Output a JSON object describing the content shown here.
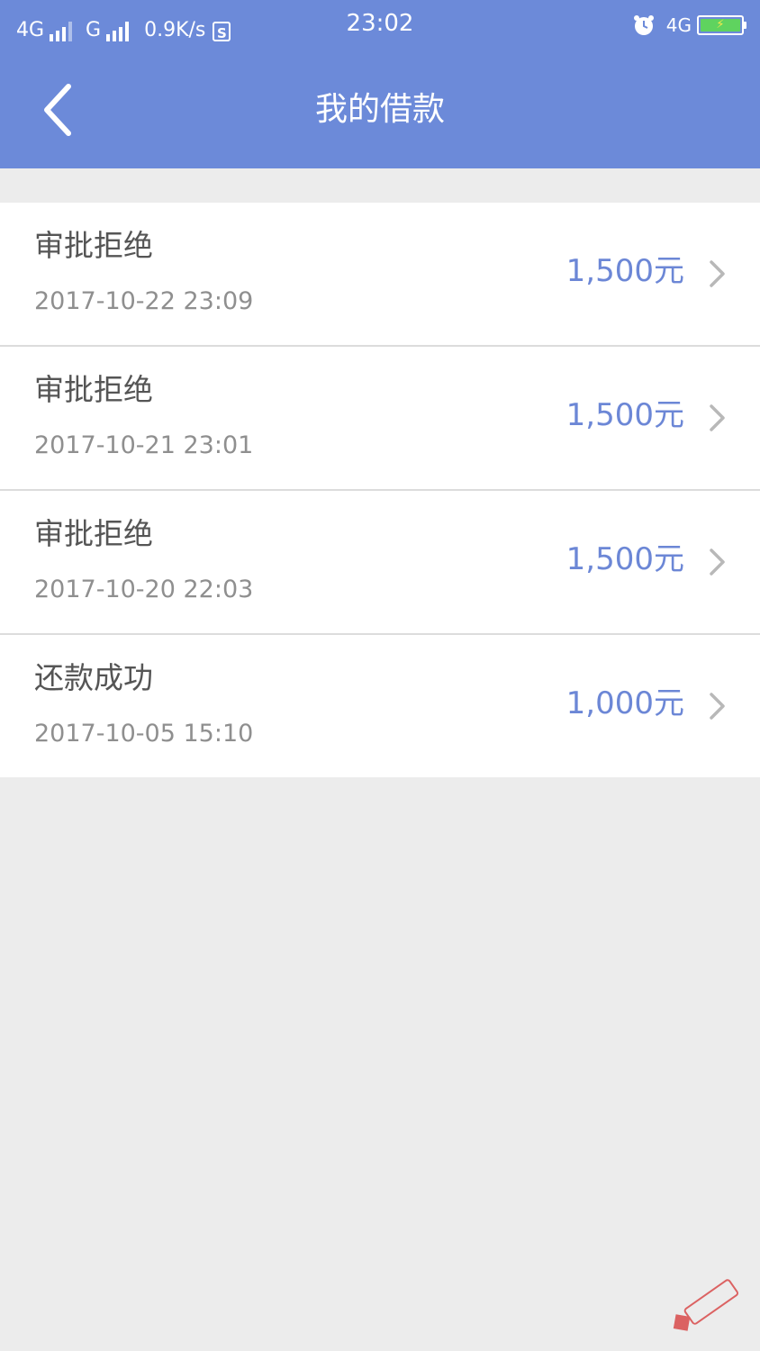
{
  "status_bar": {
    "network1": "4G",
    "network2": "G",
    "speed": "0.9K/s",
    "s_icon": "S",
    "time": "23:02",
    "right_network": "4G",
    "alarm_icon": "alarm-clock-icon",
    "battery_icon": "battery-charging-icon"
  },
  "nav": {
    "title": "我的借款",
    "back_icon": "chevron-left-icon"
  },
  "loans": [
    {
      "status": "审批拒绝",
      "time": "2017-10-22 23:09",
      "amount": "1,500元"
    },
    {
      "status": "审批拒绝",
      "time": "2017-10-21 23:01",
      "amount": "1,500元"
    },
    {
      "status": "审批拒绝",
      "time": "2017-10-20 22:03",
      "amount": "1,500元"
    },
    {
      "status": "还款成功",
      "time": "2017-10-05 15:10",
      "amount": "1,000元"
    }
  ],
  "colors": {
    "header": "#6c8ad9",
    "amount": "#6c87d6",
    "background": "#ececec"
  }
}
